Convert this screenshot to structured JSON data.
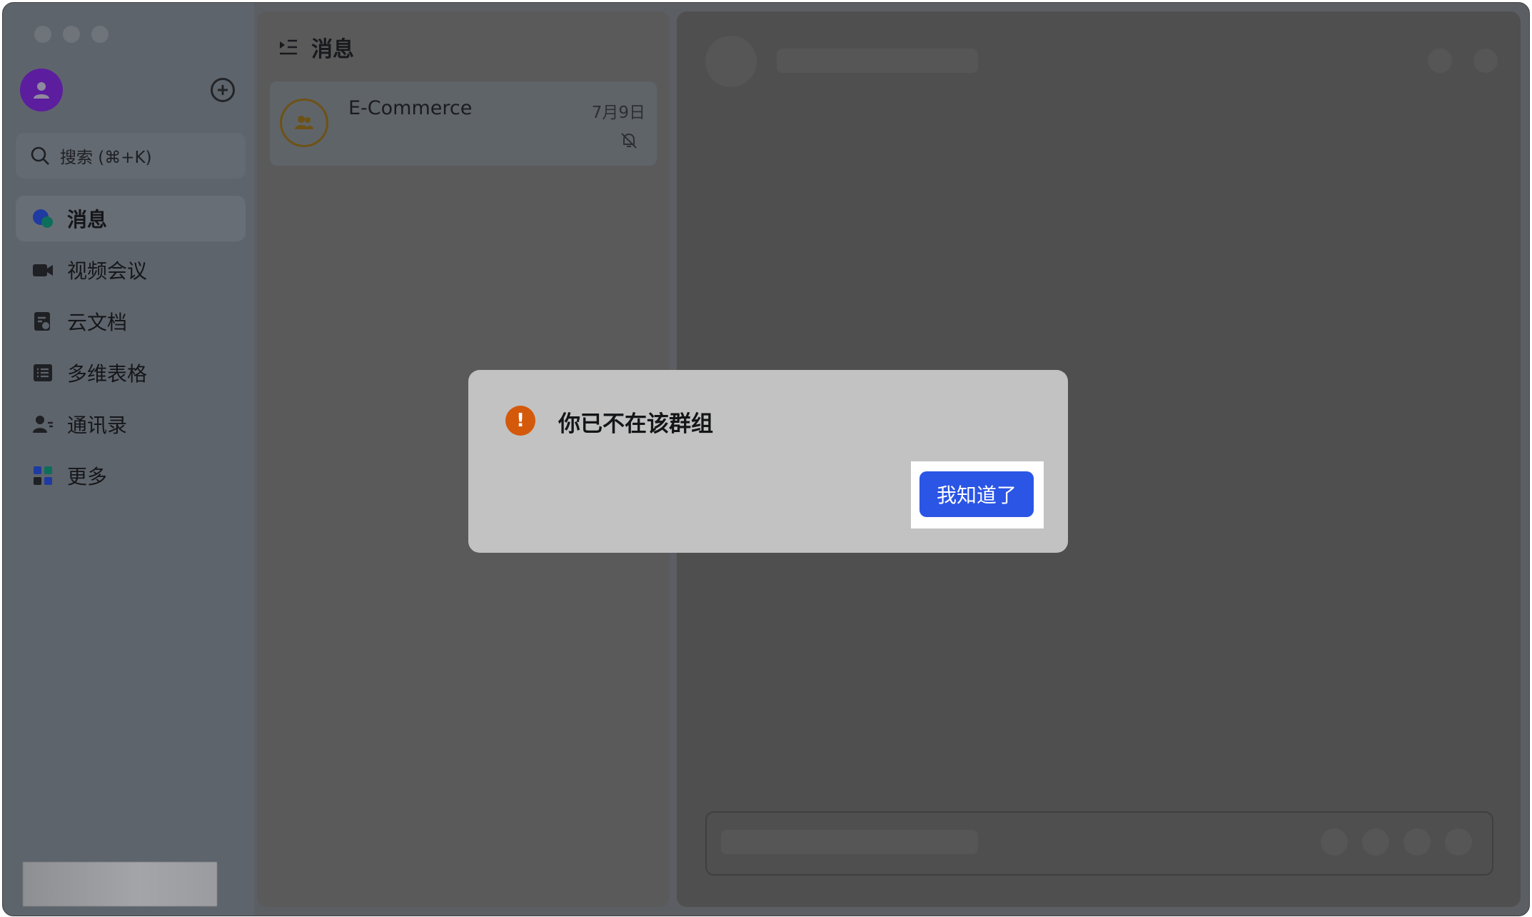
{
  "sidebar": {
    "search_placeholder": "搜索 (⌘+K)",
    "items": [
      {
        "label": "消息",
        "icon": "chat-bubbles-icon",
        "active": true
      },
      {
        "label": "视频会议",
        "icon": "video-camera-icon",
        "active": false
      },
      {
        "label": "云文档",
        "icon": "cloud-doc-icon",
        "active": false
      },
      {
        "label": "多维表格",
        "icon": "table-grid-icon",
        "active": false
      },
      {
        "label": "通讯录",
        "icon": "contacts-icon",
        "active": false
      },
      {
        "label": "更多",
        "icon": "more-apps-icon",
        "active": false
      }
    ]
  },
  "messages": {
    "title": "消息",
    "chats": [
      {
        "name": "E-Commerce",
        "date": "7月9日",
        "muted": true
      }
    ]
  },
  "dialog": {
    "title": "你已不在该群组",
    "confirm_label": "我知道了"
  },
  "colors": {
    "accent": "#2a55e5",
    "warning": "#d4590b",
    "avatar": "#5c1d9e"
  }
}
